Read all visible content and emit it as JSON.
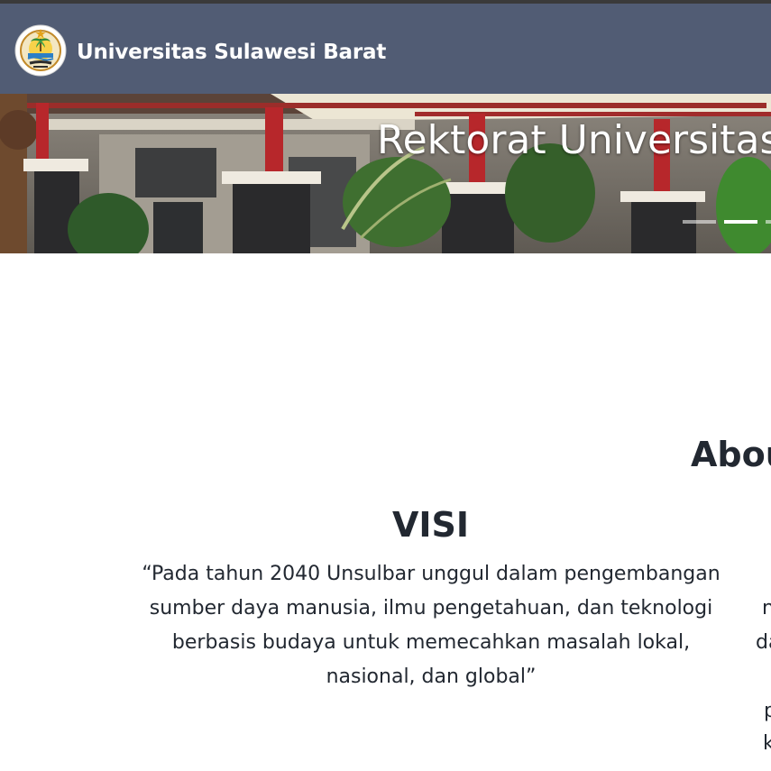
{
  "navbar": {
    "brand_name": "Universitas Sulawesi Barat",
    "logo_icon": "university-emblem-icon",
    "background_color": "#515c74"
  },
  "hero": {
    "caption": "Rektorat Universitas",
    "indicators": [
      {
        "active": false
      },
      {
        "active": true
      },
      {
        "active": false
      }
    ]
  },
  "about": {
    "title": "About",
    "visi": {
      "title": "VISI",
      "text": "“Pada tahun 2040 Unsulbar unggul dalam pengembangan sumber daya manusia, ilmu pengetahuan, dan teknologi berbasis budaya untuk memecahkan masalah lokal, nasional, dan global”"
    },
    "misi_fragments": [
      "n",
      "da",
      "p",
      "k"
    ]
  }
}
